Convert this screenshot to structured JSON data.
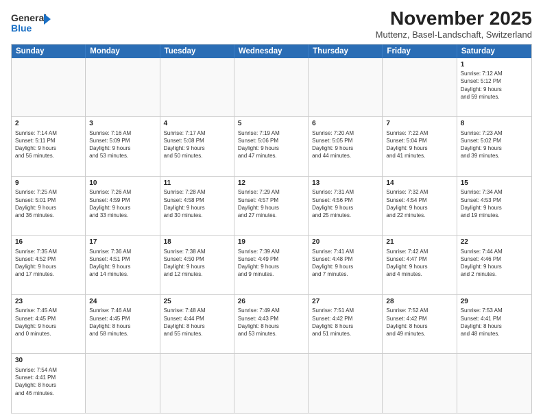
{
  "header": {
    "logo_general": "General",
    "logo_blue": "Blue",
    "month_title": "November 2025",
    "subtitle": "Muttenz, Basel-Landschaft, Switzerland"
  },
  "weekdays": [
    "Sunday",
    "Monday",
    "Tuesday",
    "Wednesday",
    "Thursday",
    "Friday",
    "Saturday"
  ],
  "rows": [
    [
      {
        "day": "",
        "info": ""
      },
      {
        "day": "",
        "info": ""
      },
      {
        "day": "",
        "info": ""
      },
      {
        "day": "",
        "info": ""
      },
      {
        "day": "",
        "info": ""
      },
      {
        "day": "",
        "info": ""
      },
      {
        "day": "1",
        "info": "Sunrise: 7:12 AM\nSunset: 5:12 PM\nDaylight: 9 hours\nand 59 minutes."
      }
    ],
    [
      {
        "day": "2",
        "info": "Sunrise: 7:14 AM\nSunset: 5:11 PM\nDaylight: 9 hours\nand 56 minutes."
      },
      {
        "day": "3",
        "info": "Sunrise: 7:16 AM\nSunset: 5:09 PM\nDaylight: 9 hours\nand 53 minutes."
      },
      {
        "day": "4",
        "info": "Sunrise: 7:17 AM\nSunset: 5:08 PM\nDaylight: 9 hours\nand 50 minutes."
      },
      {
        "day": "5",
        "info": "Sunrise: 7:19 AM\nSunset: 5:06 PM\nDaylight: 9 hours\nand 47 minutes."
      },
      {
        "day": "6",
        "info": "Sunrise: 7:20 AM\nSunset: 5:05 PM\nDaylight: 9 hours\nand 44 minutes."
      },
      {
        "day": "7",
        "info": "Sunrise: 7:22 AM\nSunset: 5:04 PM\nDaylight: 9 hours\nand 41 minutes."
      },
      {
        "day": "8",
        "info": "Sunrise: 7:23 AM\nSunset: 5:02 PM\nDaylight: 9 hours\nand 39 minutes."
      }
    ],
    [
      {
        "day": "9",
        "info": "Sunrise: 7:25 AM\nSunset: 5:01 PM\nDaylight: 9 hours\nand 36 minutes."
      },
      {
        "day": "10",
        "info": "Sunrise: 7:26 AM\nSunset: 4:59 PM\nDaylight: 9 hours\nand 33 minutes."
      },
      {
        "day": "11",
        "info": "Sunrise: 7:28 AM\nSunset: 4:58 PM\nDaylight: 9 hours\nand 30 minutes."
      },
      {
        "day": "12",
        "info": "Sunrise: 7:29 AM\nSunset: 4:57 PM\nDaylight: 9 hours\nand 27 minutes."
      },
      {
        "day": "13",
        "info": "Sunrise: 7:31 AM\nSunset: 4:56 PM\nDaylight: 9 hours\nand 25 minutes."
      },
      {
        "day": "14",
        "info": "Sunrise: 7:32 AM\nSunset: 4:54 PM\nDaylight: 9 hours\nand 22 minutes."
      },
      {
        "day": "15",
        "info": "Sunrise: 7:34 AM\nSunset: 4:53 PM\nDaylight: 9 hours\nand 19 minutes."
      }
    ],
    [
      {
        "day": "16",
        "info": "Sunrise: 7:35 AM\nSunset: 4:52 PM\nDaylight: 9 hours\nand 17 minutes."
      },
      {
        "day": "17",
        "info": "Sunrise: 7:36 AM\nSunset: 4:51 PM\nDaylight: 9 hours\nand 14 minutes."
      },
      {
        "day": "18",
        "info": "Sunrise: 7:38 AM\nSunset: 4:50 PM\nDaylight: 9 hours\nand 12 minutes."
      },
      {
        "day": "19",
        "info": "Sunrise: 7:39 AM\nSunset: 4:49 PM\nDaylight: 9 hours\nand 9 minutes."
      },
      {
        "day": "20",
        "info": "Sunrise: 7:41 AM\nSunset: 4:48 PM\nDaylight: 9 hours\nand 7 minutes."
      },
      {
        "day": "21",
        "info": "Sunrise: 7:42 AM\nSunset: 4:47 PM\nDaylight: 9 hours\nand 4 minutes."
      },
      {
        "day": "22",
        "info": "Sunrise: 7:44 AM\nSunset: 4:46 PM\nDaylight: 9 hours\nand 2 minutes."
      }
    ],
    [
      {
        "day": "23",
        "info": "Sunrise: 7:45 AM\nSunset: 4:45 PM\nDaylight: 9 hours\nand 0 minutes."
      },
      {
        "day": "24",
        "info": "Sunrise: 7:46 AM\nSunset: 4:45 PM\nDaylight: 8 hours\nand 58 minutes."
      },
      {
        "day": "25",
        "info": "Sunrise: 7:48 AM\nSunset: 4:44 PM\nDaylight: 8 hours\nand 55 minutes."
      },
      {
        "day": "26",
        "info": "Sunrise: 7:49 AM\nSunset: 4:43 PM\nDaylight: 8 hours\nand 53 minutes."
      },
      {
        "day": "27",
        "info": "Sunrise: 7:51 AM\nSunset: 4:42 PM\nDaylight: 8 hours\nand 51 minutes."
      },
      {
        "day": "28",
        "info": "Sunrise: 7:52 AM\nSunset: 4:42 PM\nDaylight: 8 hours\nand 49 minutes."
      },
      {
        "day": "29",
        "info": "Sunrise: 7:53 AM\nSunset: 4:41 PM\nDaylight: 8 hours\nand 48 minutes."
      }
    ],
    [
      {
        "day": "30",
        "info": "Sunrise: 7:54 AM\nSunset: 4:41 PM\nDaylight: 8 hours\nand 46 minutes."
      },
      {
        "day": "",
        "info": ""
      },
      {
        "day": "",
        "info": ""
      },
      {
        "day": "",
        "info": ""
      },
      {
        "day": "",
        "info": ""
      },
      {
        "day": "",
        "info": ""
      },
      {
        "day": "",
        "info": ""
      }
    ]
  ]
}
